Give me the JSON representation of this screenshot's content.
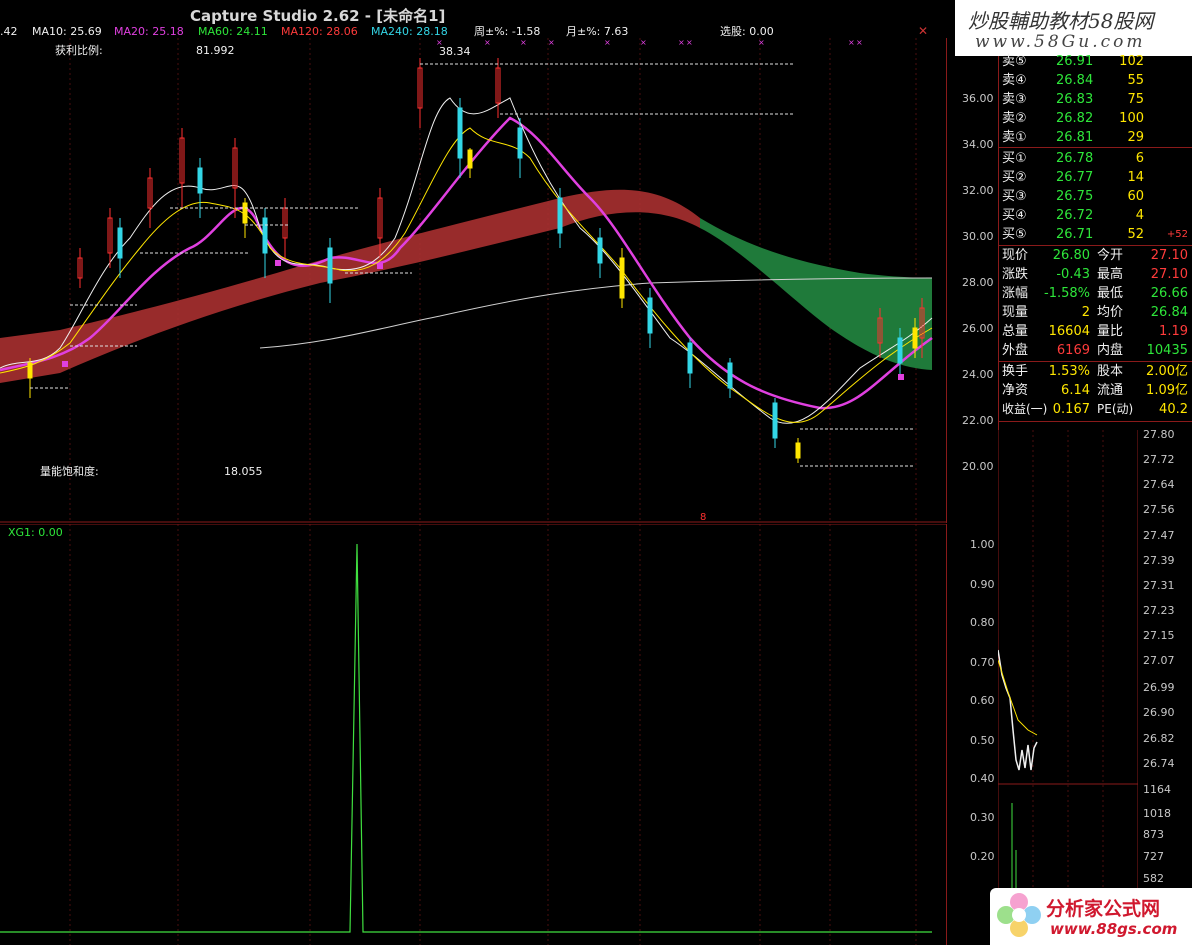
{
  "window": {
    "title": "Capture Studio 2.62 - [未命名1]",
    "close_glyph": "✕",
    "watermark_top": "炒股輔助教材58股网",
    "watermark_top_url": "www.58Gu.com",
    "watermark_bottom": "分析家公式网",
    "watermark_bottom_url": "www.88gs.com"
  },
  "header": {
    "first": ".42",
    "ma10": "MA10: 25.69",
    "ma20": "MA20: 25.18",
    "ma60": "MA60: 24.11",
    "ma120": "MA120: 28.06",
    "ma240": "MA240: 28.18",
    "week_pct": "周±%: -1.58",
    "month_pct": "月±%: 7.63",
    "xuangu": "选股: 0.00"
  },
  "main_chart": {
    "profit_ratio_label": "获利比例:",
    "profit_ratio_value": "81.992",
    "high_label": "38.34",
    "energy_label": "量能饱和度:",
    "energy_value": "18.055",
    "y_ticks": [
      "36.00",
      "34.00",
      "32.00",
      "30.00",
      "28.00",
      "26.00",
      "24.00",
      "22.00",
      "20.00"
    ]
  },
  "sub_chart": {
    "indicator": "XG1: 0.00",
    "y_ticks": [
      "1.00",
      "0.90",
      "0.80",
      "0.70",
      "0.60",
      "0.50",
      "0.40",
      "0.30",
      "0.20"
    ]
  },
  "quote": {
    "sell": [
      {
        "label": "卖⑤",
        "price": "26.91",
        "vol": "102"
      },
      {
        "label": "卖④",
        "price": "26.84",
        "vol": "55"
      },
      {
        "label": "卖③",
        "price": "26.83",
        "vol": "75"
      },
      {
        "label": "卖②",
        "price": "26.82",
        "vol": "100"
      },
      {
        "label": "卖①",
        "price": "26.81",
        "vol": "29"
      }
    ],
    "buy": [
      {
        "label": "买①",
        "price": "26.78",
        "vol": "6"
      },
      {
        "label": "买②",
        "price": "26.77",
        "vol": "14"
      },
      {
        "label": "买③",
        "price": "26.75",
        "vol": "60"
      },
      {
        "label": "买④",
        "price": "26.72",
        "vol": "4"
      },
      {
        "label": "买⑤",
        "price": "26.71",
        "vol": "52",
        "extra": "+52"
      }
    ],
    "stats": [
      {
        "l1": "现价",
        "v1": "26.80",
        "l2": "今开",
        "v2": "27.10"
      },
      {
        "l1": "涨跌",
        "v1": "-0.43",
        "l2": "最高",
        "v2": "27.10"
      },
      {
        "l1": "涨幅",
        "v1": "-1.58%",
        "l2": "最低",
        "v2": "26.66"
      },
      {
        "l1": "现量",
        "v1": "2",
        "l2": "均价",
        "v2": "26.84"
      },
      {
        "l1": "总量",
        "v1": "16604",
        "l2": "量比",
        "v2": "1.19"
      },
      {
        "l1": "外盘",
        "v1": "6169",
        "l2": "内盘",
        "v2": "10435"
      },
      {
        "l1": "换手",
        "v1": "1.53%",
        "l2": "股本",
        "v2": "2.00亿"
      },
      {
        "l1": "净资",
        "v1": "6.14",
        "l2": "流通",
        "v2": "1.09亿"
      },
      {
        "l1": "收益(一)",
        "v1": "0.167",
        "l2": "PE(动)",
        "v2": "40.2"
      }
    ]
  },
  "mini_chart": {
    "price_ticks": [
      "27.80",
      "27.72",
      "27.64",
      "27.56",
      "27.47",
      "27.39",
      "27.31",
      "27.23",
      "27.15",
      "27.07",
      "26.99",
      "26.90",
      "26.82",
      "26.74"
    ],
    "vol_ticks": [
      "1164",
      "1018",
      "873",
      "727",
      "582"
    ]
  },
  "colors": {
    "bg": "#000000",
    "grid": "#8a1a1a",
    "up": "#ff3030",
    "down": "#33d6e6",
    "ma_white": "#f0f0f0",
    "ma_yellow": "#ffe600",
    "ma_magenta": "#e040e0",
    "band_red": "#a83030",
    "band_green": "#1f7a3a",
    "signal_green": "#40e040"
  },
  "icons": [
    "close-icon",
    "pin-marker-icon"
  ]
}
